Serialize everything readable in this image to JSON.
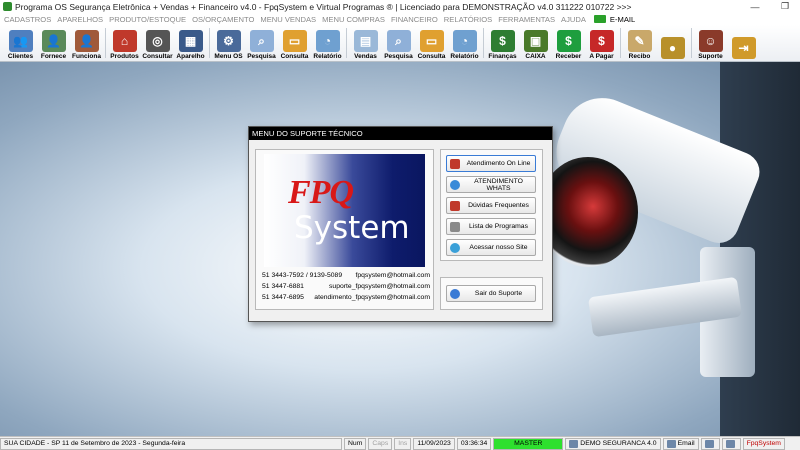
{
  "window": {
    "title": "Programa OS Segurança Eletrônica + Vendas + Financeiro v4.0 - FpqSystem e Virtual Programas ® | Licenciado para  DEMONSTRAÇÃO v4.0 311222 010722 >>>",
    "controls": [
      "—",
      "❐"
    ]
  },
  "menubar": {
    "items": [
      "CADASTROS",
      "APARELHOS",
      "PRODUTO/ESTOQUE",
      "OS/ORÇAMENTO",
      "MENU VENDAS",
      "MENU COMPRAS",
      "FINANCEIRO",
      "RELATÓRIOS",
      "FERRAMENTAS",
      "AJUDA"
    ],
    "email_label": "E-MAIL"
  },
  "toolbar": {
    "buttons": [
      {
        "label": "Clientes",
        "icon": "clients-icon",
        "color": "#4f7fbf",
        "glyph": "👥"
      },
      {
        "label": "Fornece",
        "icon": "supplier-icon",
        "color": "#5a8a5a",
        "glyph": "👤"
      },
      {
        "label": "Funciona",
        "icon": "employee-icon",
        "color": "#a05a3a",
        "glyph": "👤"
      },
      {
        "label": "Produtos",
        "icon": "products-icon",
        "color": "#c0392b",
        "glyph": "⌂"
      },
      {
        "label": "Consultar",
        "icon": "consult-icon",
        "color": "#555555",
        "glyph": "◎"
      },
      {
        "label": "Aparelho",
        "icon": "device-icon",
        "color": "#3a5a8a",
        "glyph": "▦"
      },
      {
        "label": "Menu OS",
        "icon": "menu-os-icon",
        "color": "#4a6a9a",
        "glyph": "⚙"
      },
      {
        "label": "Pesquisa",
        "icon": "search-icon",
        "color": "#8fb0d8",
        "glyph": "⌕"
      },
      {
        "label": "Consulta",
        "icon": "folder-icon",
        "color": "#e0a030",
        "glyph": "▭"
      },
      {
        "label": "Relatório",
        "icon": "report-icon",
        "color": "#6fa0d0",
        "glyph": "◔"
      },
      {
        "label": "Vendas",
        "icon": "sales-icon",
        "color": "#9ab8d8",
        "glyph": "▤"
      },
      {
        "label": "Pesquisa",
        "icon": "search-icon",
        "color": "#8fb0d8",
        "glyph": "⌕"
      },
      {
        "label": "Consulta",
        "icon": "folder-icon",
        "color": "#e0a030",
        "glyph": "▭"
      },
      {
        "label": "Relatório",
        "icon": "report-icon",
        "color": "#6fa0d0",
        "glyph": "◔"
      },
      {
        "label": "Finanças",
        "icon": "finance-icon",
        "color": "#2e7d32",
        "glyph": "$"
      },
      {
        "label": "CAIXA",
        "icon": "cash-icon",
        "color": "#4a7a2a",
        "glyph": "▣"
      },
      {
        "label": "Receber",
        "icon": "receive-icon",
        "color": "#1e9e3e",
        "glyph": "$"
      },
      {
        "label": "A Pagar",
        "icon": "pay-icon",
        "color": "#c62828",
        "glyph": "$"
      },
      {
        "label": "Recibo",
        "icon": "receipt-icon",
        "color": "#c9a86a",
        "glyph": "✎"
      },
      {
        "label": "",
        "icon": "coins-icon",
        "color": "#b8902a",
        "glyph": "●"
      },
      {
        "label": "Suporte",
        "icon": "support-icon",
        "color": "#8a3a2a",
        "glyph": "☺"
      },
      {
        "label": "",
        "icon": "exit-icon",
        "color": "#d09a2a",
        "glyph": "⇥"
      }
    ]
  },
  "dialog": {
    "title": "MENU DO SUPORTE TÉCNICO",
    "logo": {
      "line1": "FPQ",
      "line2": "System"
    },
    "contacts": [
      {
        "phone": "51 3443-7592 / 9139-5089",
        "email": "fpqsystem@hotmail.com"
      },
      {
        "phone": "51 3447-6881",
        "email": "suporte_fpqsystem@hotmail.com"
      },
      {
        "phone": "51 3447-6895",
        "email": "atendimento_fpqsystem@hotmail.com"
      }
    ],
    "buttons": [
      {
        "label": "Atendimento On Line",
        "icon": "chat-icon",
        "color": "#c0392b"
      },
      {
        "label": "ATENDIMENTO WHATS",
        "icon": "whatsapp-icon",
        "color": "#3a8ad8"
      },
      {
        "label": "Dúvidas Frequentes",
        "icon": "faq-icon",
        "color": "#c0392b"
      },
      {
        "label": "Lista de Programas",
        "icon": "list-icon",
        "color": "#8a8a8a"
      },
      {
        "label": "Acessar nosso Site",
        "icon": "web-icon",
        "color": "#3aa0d8"
      }
    ],
    "exit_button": {
      "label": "Sair do Suporte",
      "icon": "exit-icon",
      "color": "#3a7bd5"
    }
  },
  "statusbar": {
    "city": "SUA CIDADE - SP 11 de Setembro de 2023 - Segunda-feira",
    "num": "Num",
    "caps": "Caps",
    "ins": "Ins",
    "date": "11/09/2023",
    "time": "03:36:34",
    "user": "MASTER",
    "database": "DEMO SEGURANCA 4.0",
    "email": "Email",
    "brand": "FpqSystem"
  }
}
